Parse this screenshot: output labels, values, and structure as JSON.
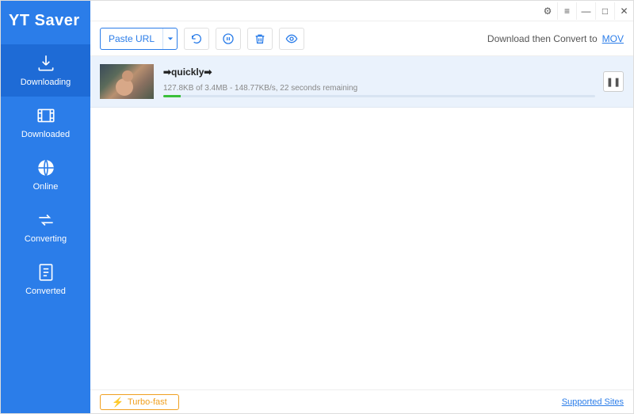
{
  "app": {
    "title": "YT Saver"
  },
  "sidebar": {
    "items": [
      {
        "label": "Downloading"
      },
      {
        "label": "Downloaded"
      },
      {
        "label": "Online"
      },
      {
        "label": "Converting"
      },
      {
        "label": "Converted"
      }
    ]
  },
  "toolbar": {
    "paste_label": "Paste URL",
    "convert_label": "Download then Convert to",
    "format": "MOV"
  },
  "downloads": [
    {
      "title": "➡quickly➡",
      "status": "127.8KB of 3.4MB - 148.77KB/s, 22 seconds remaining",
      "progress_pct": 4
    }
  ],
  "footer": {
    "turbo_label": "Turbo-fast",
    "supported_label": "Supported Sites"
  }
}
